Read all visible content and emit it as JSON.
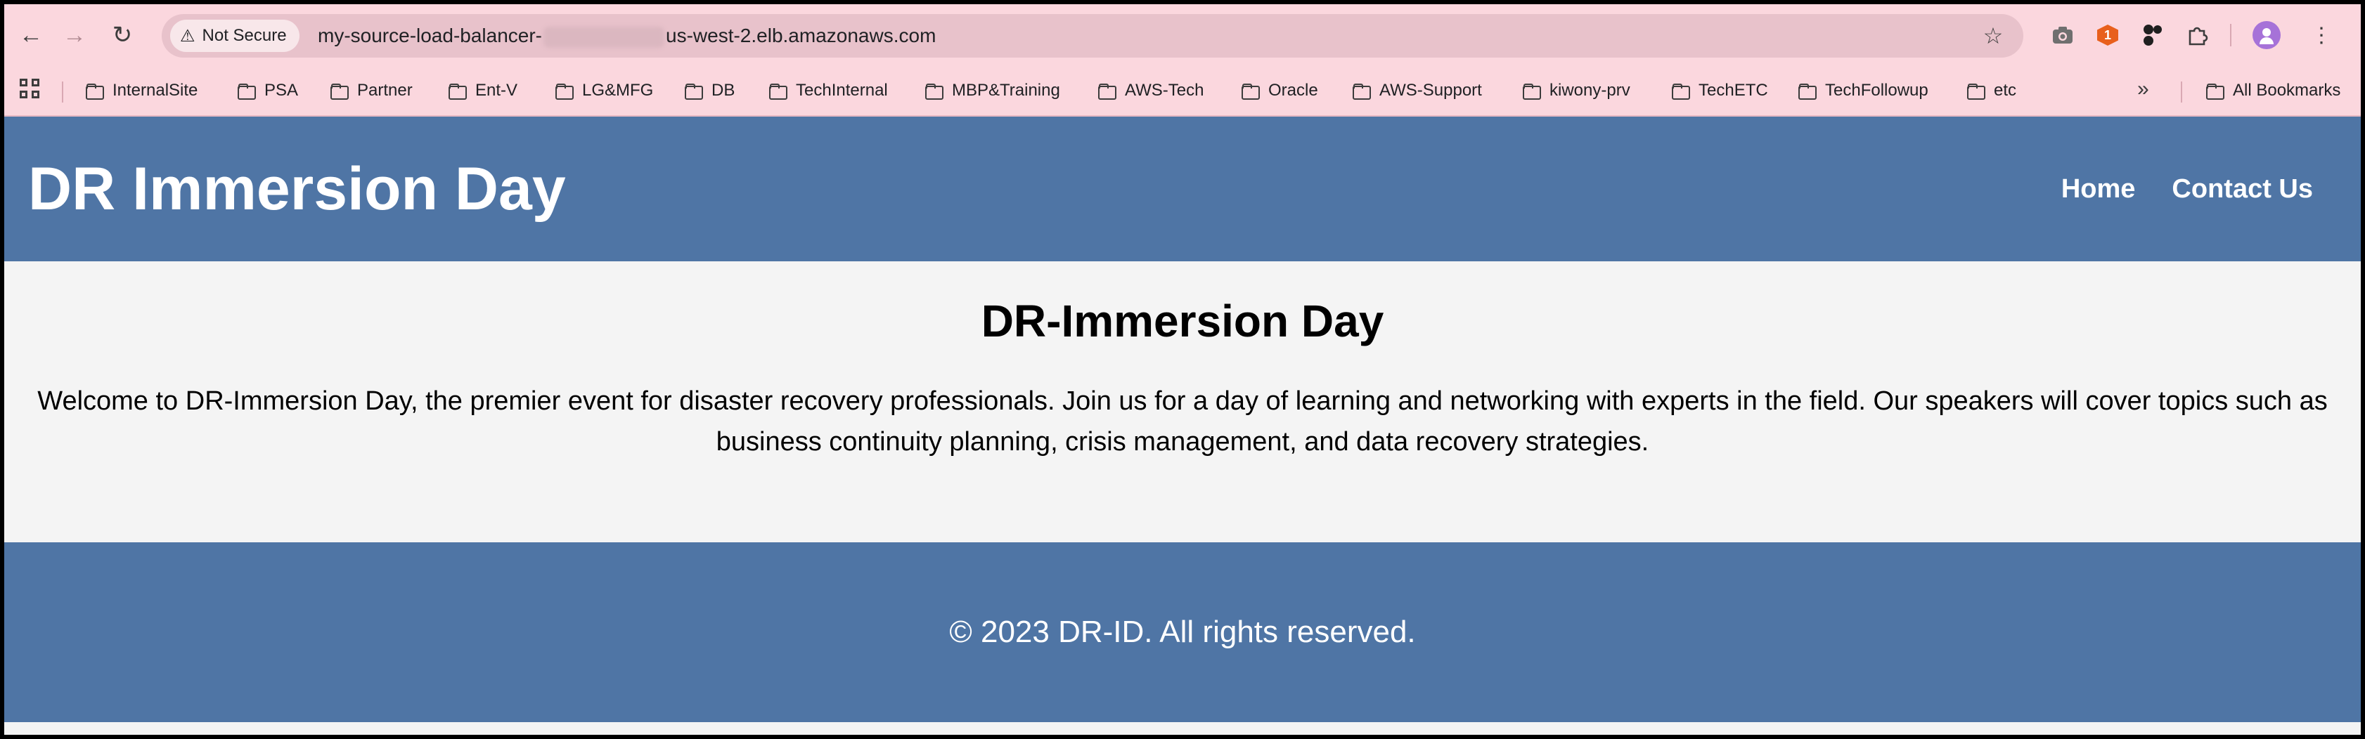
{
  "browser": {
    "security_label": "Not Secure",
    "url_prefix": "my-source-load-balancer-",
    "url_suffix": "us-west-2.elb.amazonaws.com",
    "extension_badge": "1",
    "bookmarks": [
      "InternalSite",
      "PSA",
      "Partner",
      "Ent-V",
      "LG&MFG",
      "DB",
      "TechInternal",
      "MBP&Training",
      "AWS-Tech",
      "Oracle",
      "AWS-Support",
      "kiwony-prv",
      "TechETC",
      "TechFollowup",
      "etc"
    ],
    "more_bookmarks": "»",
    "all_bookmarks": "All Bookmarks"
  },
  "site": {
    "title": "DR Immersion Day",
    "nav": [
      "Home",
      "Contact Us"
    ],
    "heading": "DR-Immersion Day",
    "intro": "Welcome to DR-Immersion Day, the premier event for disaster recovery professionals. Join us for a day of learning and networking with experts in the field. Our speakers will cover topics such as business continuity planning, crisis management, and data recovery strategies.",
    "footer": "© 2023 DR-ID. All rights reserved."
  },
  "colors": {
    "chrome_bg": "#fbd7de",
    "header_bg": "#4f75a5",
    "content_bg": "#f4f4f4"
  }
}
